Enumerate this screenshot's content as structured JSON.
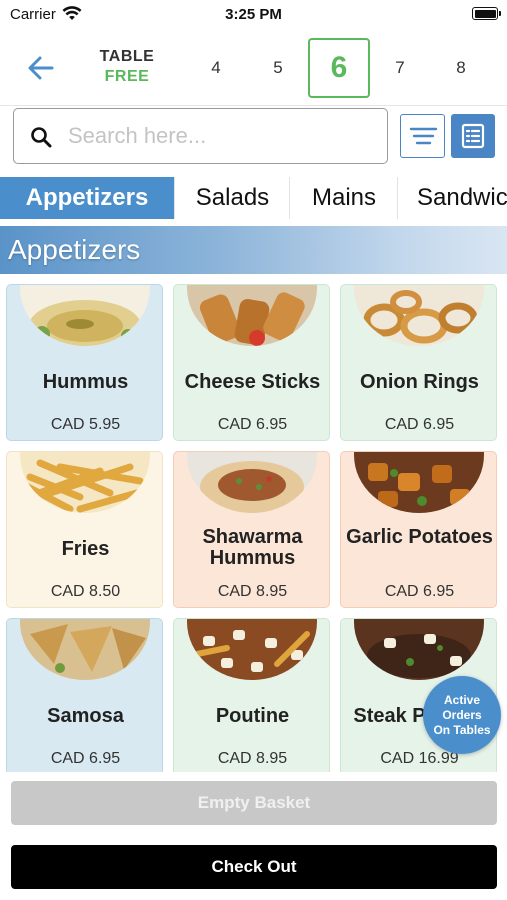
{
  "status_bar": {
    "carrier": "Carrier",
    "time": "3:25 PM"
  },
  "table_bar": {
    "status_label": "TABLE",
    "status_value": "FREE",
    "tables": [
      "4",
      "5",
      "6",
      "7",
      "8"
    ],
    "selected_table": "6"
  },
  "search": {
    "placeholder": "Search here..."
  },
  "categories": [
    "Appetizers",
    "Salads",
    "Mains",
    "Sandwiches"
  ],
  "active_category": "Appetizers",
  "section_title": "Appetizers",
  "items": [
    {
      "name": "Hummus",
      "price": "CAD 5.95"
    },
    {
      "name": "Cheese Sticks",
      "price": "CAD 6.95"
    },
    {
      "name": "Onion Rings",
      "price": "CAD 6.95"
    },
    {
      "name": "Fries",
      "price": "CAD 8.50"
    },
    {
      "name": "Shawarma Hummus",
      "price": "CAD 8.95"
    },
    {
      "name": "Garlic Potatoes",
      "price": "CAD 6.95"
    },
    {
      "name": "Samosa",
      "price": "CAD 6.95"
    },
    {
      "name": "Poutine",
      "price": "CAD 8.95"
    },
    {
      "name": "Steak Poutine",
      "price": "CAD 16.99"
    }
  ],
  "floating_button": {
    "label": "Active Orders On Tables"
  },
  "buttons": {
    "empty_basket": "Empty Basket",
    "check_out": "Check Out"
  },
  "colors": {
    "accent_blue": "#4a8fcb",
    "free_green": "#5cb85c",
    "card_blue": "#d8e9f2",
    "card_green": "#e5f3e9",
    "card_cream": "#fcf5e5",
    "card_peach": "#fce6d8"
  }
}
